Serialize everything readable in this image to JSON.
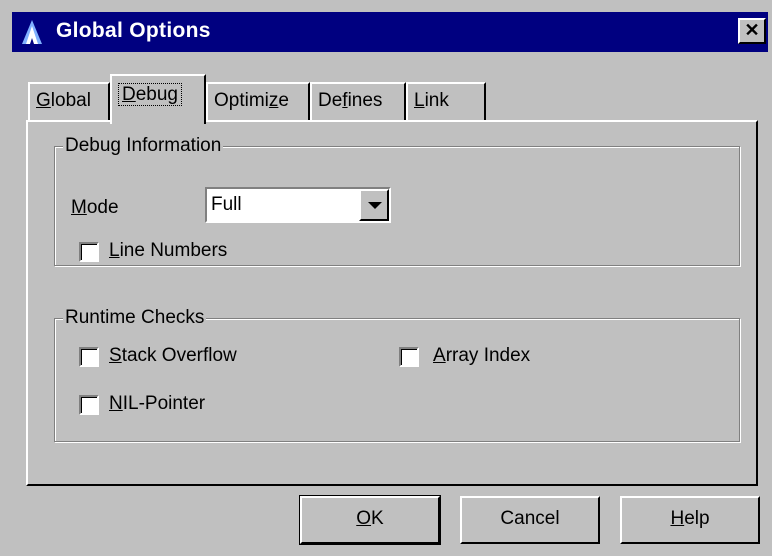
{
  "window": {
    "title": "Global Options",
    "close_glyph": "✕",
    "icon": "app-icon"
  },
  "tabs": [
    {
      "label": "Global",
      "mnemonic": "G",
      "rest": "lobal",
      "active": false
    },
    {
      "label": "Debug",
      "mnemonic": "D",
      "rest": "ebug",
      "active": true
    },
    {
      "label": "Optimize",
      "pre": "Optimi",
      "mnemonic": "z",
      "rest": "e",
      "active": false
    },
    {
      "label": "Defines",
      "pre": "De",
      "mnemonic": "f",
      "rest": "ines",
      "active": false
    },
    {
      "label": "Link",
      "mnemonic": "L",
      "rest": "ink",
      "active": false
    }
  ],
  "debug_info": {
    "legend": "Debug Information",
    "mode_label": {
      "mnemonic": "M",
      "rest": "ode"
    },
    "mode_value": "Full",
    "line_numbers": {
      "pre": "",
      "mnemonic": "L",
      "rest": "ine Numbers",
      "checked": false
    }
  },
  "runtime_checks": {
    "legend": "Runtime Checks",
    "stack_overflow": {
      "mnemonic": "S",
      "rest": "tack Overflow",
      "checked": false
    },
    "array_index": {
      "mnemonic": "A",
      "rest": "rray Index",
      "checked": false
    },
    "nil_pointer": {
      "mnemonic": "N",
      "rest": "IL-Pointer",
      "checked": false
    }
  },
  "buttons": {
    "ok": {
      "mnemonic": "O",
      "rest": "K"
    },
    "cancel": "Cancel",
    "help": {
      "mnemonic": "H",
      "rest": "elp"
    }
  },
  "colors": {
    "face": "#c0c0c0",
    "titlebar": "#000080",
    "highlight": "#ffffff",
    "shadow": "#808080"
  }
}
